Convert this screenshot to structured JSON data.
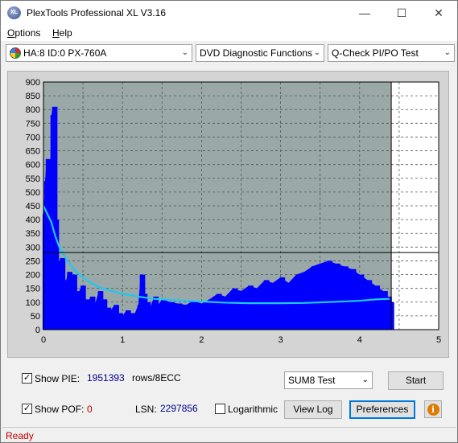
{
  "window": {
    "title": "PlexTools Professional XL V3.16",
    "app_icon_text": "XL"
  },
  "menu": {
    "options_hot": "O",
    "options_rest": "ptions",
    "help_hot": "H",
    "help_rest": "elp"
  },
  "toolbar": {
    "drive": "HA:8 ID:0  PX-760A",
    "function": "DVD Diagnostic Functions",
    "test": "Q-Check PI/PO Test"
  },
  "chart_data": {
    "type": "bar",
    "x_ticks": [
      "0",
      "1",
      "2",
      "3",
      "4",
      "5"
    ],
    "y_ticks": [
      "0",
      "50",
      "100",
      "150",
      "200",
      "250",
      "300",
      "350",
      "400",
      "450",
      "500",
      "550",
      "600",
      "650",
      "700",
      "750",
      "800",
      "850",
      "900"
    ],
    "xlim": [
      0,
      5
    ],
    "ylim": [
      0,
      900
    ],
    "grid": true,
    "colors": {
      "bars": "#0000ff",
      "average": "#1ec8f0",
      "background": "#9aa8a8",
      "border": "#000000"
    },
    "vertical_marker_x": 4.4,
    "horizontal_marker_y": 280,
    "series": [
      {
        "type": "bar",
        "x": [
          0.0,
          0.02,
          0.04,
          0.06,
          0.08,
          0.1,
          0.12,
          0.14,
          0.16,
          0.18,
          0.2,
          0.22,
          0.25,
          0.28,
          0.31,
          0.34,
          0.37,
          0.4,
          0.44,
          0.48,
          0.52,
          0.56,
          0.6,
          0.65,
          0.7,
          0.75,
          0.8,
          0.85,
          0.9,
          0.95,
          1.0,
          1.05,
          1.1,
          1.15,
          1.2,
          1.23,
          1.26,
          1.3,
          1.35,
          1.4,
          1.45,
          1.5,
          1.6,
          1.7,
          1.8,
          1.9,
          2.0,
          2.1,
          2.2,
          2.3,
          2.4,
          2.5,
          2.6,
          2.7,
          2.8,
          2.9,
          3.0,
          3.1,
          3.2,
          3.3,
          3.4,
          3.5,
          3.6,
          3.7,
          3.8,
          3.9,
          4.0,
          4.1,
          4.2,
          4.3,
          4.35,
          4.38
        ],
        "values": [
          420,
          540,
          620,
          300,
          500,
          780,
          810,
          400,
          250,
          230,
          220,
          260,
          180,
          170,
          210,
          150,
          200,
          140,
          130,
          160,
          110,
          100,
          120,
          90,
          140,
          110,
          80,
          70,
          90,
          60,
          50,
          70,
          60,
          55,
          90,
          200,
          130,
          100,
          80,
          120,
          90,
          110,
          100,
          95,
          90,
          105,
          95,
          110,
          130,
          120,
          150,
          140,
          160,
          150,
          180,
          170,
          190,
          170,
          200,
          210,
          230,
          240,
          250,
          240,
          230,
          220,
          200,
          180,
          160,
          140,
          120,
          100
        ]
      },
      {
        "type": "line",
        "name": "average",
        "x": [
          0.0,
          0.05,
          0.1,
          0.15,
          0.2,
          0.3,
          0.4,
          0.5,
          0.6,
          0.7,
          0.8,
          0.9,
          1.0,
          1.1,
          1.2,
          1.4,
          1.6,
          1.8,
          2.0,
          2.3,
          2.6,
          3.0,
          3.3,
          3.6,
          4.0,
          4.2,
          4.38
        ],
        "values": [
          450,
          420,
          390,
          340,
          300,
          250,
          215,
          190,
          170,
          155,
          145,
          138,
          130,
          125,
          120,
          112,
          108,
          105,
          102,
          98,
          96,
          96,
          97,
          100,
          105,
          110,
          112
        ]
      }
    ]
  },
  "bottom": {
    "show_pie_label": "Show PIE:",
    "show_pie_value": "1951393",
    "show_pie_unit": "rows/8ECC",
    "show_pof_label": "Show POF:",
    "show_pof_value": "0",
    "lsn_label": "LSN:",
    "lsn_value": "2297856",
    "logarithmic_label": "Logarithmic",
    "sum8_select": "SUM8 Test",
    "start_label": "Start",
    "view_log_label": "View Log",
    "preferences_label": "Preferences",
    "info_glyph": "i"
  },
  "status": {
    "text": "Ready"
  }
}
